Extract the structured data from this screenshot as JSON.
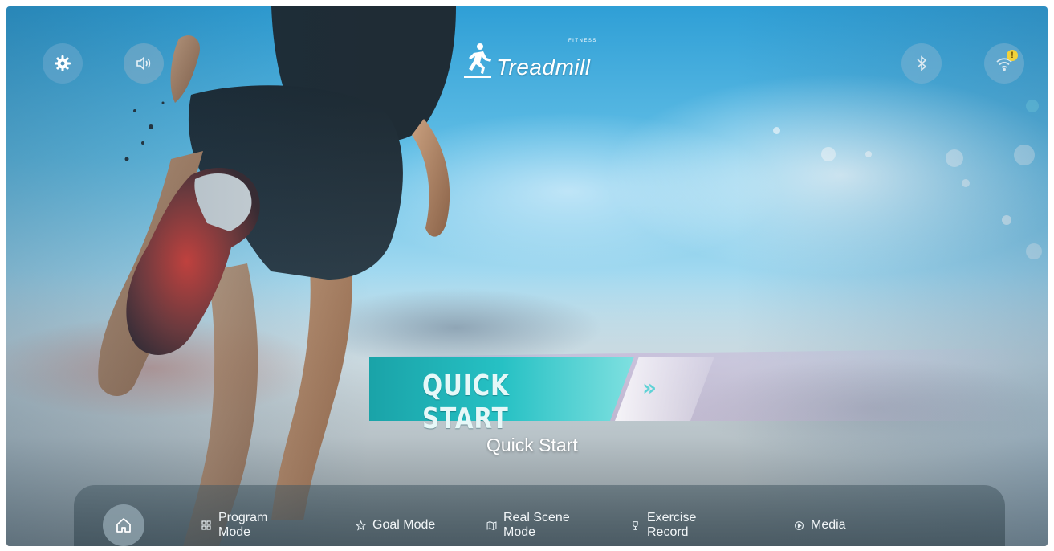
{
  "header": {
    "brand": "Treadmill",
    "brand_sub": "FITNESS",
    "icons": [
      "settings-gear-icon",
      "volume-icon",
      "bluetooth-icon",
      "wifi-icon"
    ],
    "wifi_alert": "!"
  },
  "main": {
    "quick_start_banner": "QUICK START",
    "quick_start_arrow": "»",
    "quick_start_label": "Quick Start"
  },
  "bottom_nav": {
    "items": [
      {
        "label": "",
        "icon": "home-icon"
      },
      {
        "label": "Program\nMode",
        "line1": "Program",
        "line2": "Mode",
        "icon": "grid-icon"
      },
      {
        "label": "Goal Mode",
        "icon": "star-icon"
      },
      {
        "label": "Real Scene\nMode",
        "line1": "Real Scene",
        "line2": "Mode",
        "icon": "map-icon"
      },
      {
        "label": "Exercise\nRecord",
        "line1": "Exercise",
        "line2": "Record",
        "icon": "trophy-icon"
      },
      {
        "label": "Media",
        "icon": "play-icon"
      }
    ]
  },
  "colors": {
    "accent_teal": "#5fd2d6",
    "sky_blue": "#2f9fd6",
    "wifi_alert_yellow": "#f2d23a"
  }
}
